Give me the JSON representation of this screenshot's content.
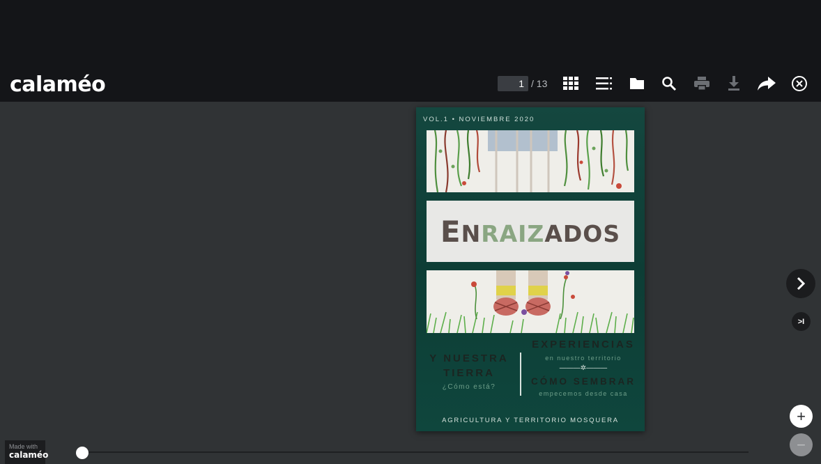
{
  "app": {
    "logo": "calaméo"
  },
  "toolbar": {
    "current_page": "1",
    "total_pages": "/ 13",
    "icons": [
      "grid-view-icon",
      "list-view-icon",
      "folder-icon",
      "search-icon",
      "print-icon",
      "download-icon",
      "share-icon",
      "close-icon"
    ]
  },
  "cover": {
    "volume": "VOL.1 • NOVIEMBRE 2020",
    "title_part1": "E",
    "title_part2": "N",
    "title_part3": "RAIZ",
    "title_part4": "ADOS",
    "left_heading_1": "Y NUESTRA",
    "left_heading_2": "TIERRA",
    "left_sub": "¿Cómo está?",
    "right_heading_1": "EXPERIENCIAS",
    "right_sub_1": "en nuestro territorio",
    "right_heading_2": "CÓMO SEMBRAR",
    "right_sub_2": "empecemos desde casa",
    "footer": "AGRICULTURA Y TERRITORIO MOSQUERA",
    "colors": {
      "background": "#0f463d",
      "title_dark": "#5a4f4b",
      "title_green": "#8aa682"
    }
  },
  "navigation": {
    "next_icon": "chevron-right-icon",
    "last_icon": "skip-to-last-icon",
    "last_label": ">I",
    "zoom_in_label": "+",
    "zoom_out_label": "−"
  },
  "footer": {
    "made_with": "Made with",
    "brand": "calaméo",
    "slider_position": 0
  }
}
